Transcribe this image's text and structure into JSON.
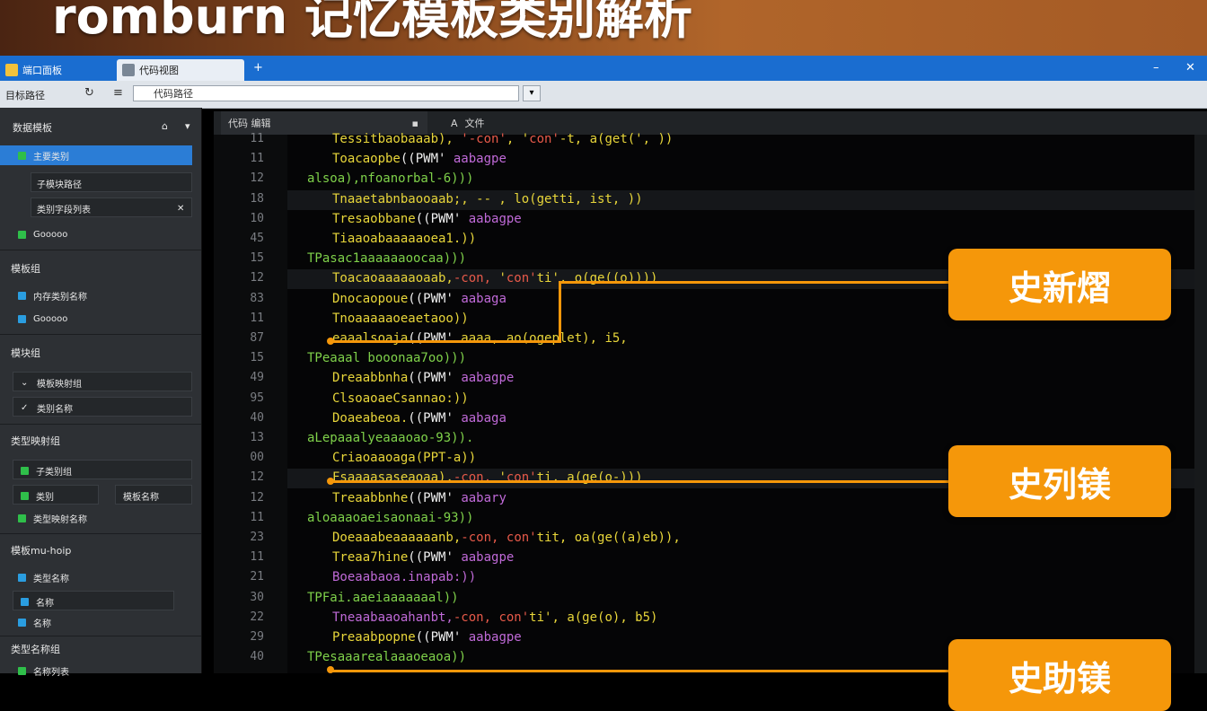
{
  "banner": {
    "title": "romburn 记忆模板类别解析"
  },
  "tabs": [
    {
      "label": "端口面板"
    },
    {
      "label": "代码视图"
    }
  ],
  "address": {
    "label": "目标路径",
    "value": "代码路径"
  },
  "sidebar": {
    "header": "数据模板",
    "groups": [
      {
        "items": [
          {
            "label": "主要类别"
          },
          {
            "label": "子模块路径"
          },
          {
            "label": "类别字段列表"
          },
          {
            "label": "Gooooo"
          }
        ]
      },
      {
        "title": "模板组",
        "items": [
          {
            "label": "内存类别名称"
          },
          {
            "label": "Gooooo"
          }
        ]
      },
      {
        "title": "模块组",
        "items": [
          {
            "label": "模板映射组"
          },
          {
            "label": "类别名称"
          }
        ]
      },
      {
        "title": "类型映射组",
        "items": [
          {
            "label": "子类别组"
          },
          {
            "label": "类别"
          },
          {
            "label": "模板名称"
          },
          {
            "label": "类型映射名称"
          }
        ]
      },
      {
        "title": "模板mu-hoip",
        "items": [
          {
            "label": "类型名称"
          },
          {
            "label": "名称"
          },
          {
            "label": "名称"
          }
        ]
      },
      {
        "title": "类型名称组",
        "items": [
          {
            "label": "名称列表"
          }
        ]
      }
    ]
  },
  "editor": {
    "tab1": "代码 编辑",
    "tab2": "文件",
    "line_numbers": [
      "11",
      "11",
      "12",
      "18",
      "10",
      "45",
      "15",
      "12",
      "83",
      "11",
      "87",
      "15",
      "49",
      "95",
      "40",
      "13",
      "00",
      "12",
      "12",
      "11",
      "23",
      "11",
      "21",
      "30",
      "22",
      "29",
      "40"
    ],
    "lines": [
      "Tessitbaobaaab), '-con', 'con'-t, a(get(', ))",
      "Toacaopbe((PWM' aabagpe",
      "alsoa),nfoanorbal-6)))",
      "Tnaaetabnbaooaab;, -- , lo(getti, ist, ))",
      "Tresaobbane((PWM' aabagpe",
      "Tiaaoabaaaaaoea1.))",
      "TPasac1aaaaaaoocaa)))",
      "Toacaoaaaaaoaab,-con, 'con'ti', o(ge((o))))",
      "Dnocaopoue((PWM' aabaga",
      "Tnoaaaaaoeaetaoo))",
      "eaaalsoaja((PWM' aaaa, ao(ogeplet), i5,",
      "TPeaaal booonaa7oo)))",
      "Dreaabbnha((PWM' aabagpe",
      "ClsoaoaeCsannao:))",
      "Doaeabeoa.((PWM' aabaga",
      "aLepaaalyeaaaoao-93)).",
      "Criaoaaoaga(PPT-a))",
      "Fsaaaasaseaoaa),-con, 'con'ti, a(ge(o-)))",
      "Treaabbnhe((PWM' aabary",
      "aloaaaoaeisaonaai-93))",
      "Doeaaabeaaaaaanb,-con, con'tit, oa(ge((a)eb)),",
      "Treaa7hine((PWM' aabagpe",
      "Boeaabaoa.inapab:))",
      "TPFai.aaeiaaaaaaal))",
      "Tneaabaaoahanbt,-con, con'ti', a(ge(o), b5)",
      "Preaabpopne((PWM' aabagpe",
      "TPesaaarealaaaoeaoa))"
    ]
  },
  "callouts": [
    {
      "label": "史新熠"
    },
    {
      "label": "史列镁"
    },
    {
      "label": "史助镁"
    }
  ],
  "colors": {
    "accent": "#f5970a",
    "tabbar": "#1a6dd0",
    "editor_bg": "#050506"
  },
  "window_controls": {
    "minimize": "–",
    "close": "✕"
  }
}
